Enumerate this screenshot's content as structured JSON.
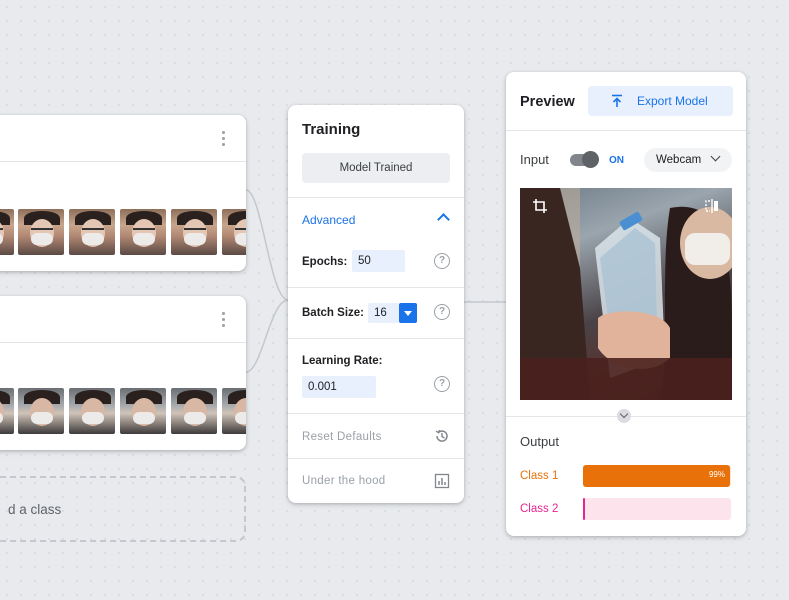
{
  "add_class": {
    "label": "d a class"
  },
  "training": {
    "title": "Training",
    "train_button": "Model Trained",
    "advanced_label": "Advanced",
    "epochs": {
      "label": "Epochs:",
      "value": "50"
    },
    "batch_size": {
      "label": "Batch Size:",
      "value": "16"
    },
    "learning_rate": {
      "label": "Learning Rate:",
      "value": "0.001"
    },
    "reset_defaults": "Reset Defaults",
    "under_the_hood": "Under the hood",
    "help_glyph": "?"
  },
  "preview": {
    "title": "Preview",
    "export_label": "Export Model",
    "input_label": "Input",
    "toggle_state": "ON",
    "source_select": "Webcam",
    "output_label": "Output",
    "classes": [
      {
        "name": "Class 1",
        "confidence": 0.99,
        "percent_text": "99%",
        "color": "#e8710a",
        "track": "#fde6cf"
      },
      {
        "name": "Class 2",
        "confidence": 0.01,
        "percent_text": "",
        "color": "#e52592",
        "track": "#fde4ec"
      }
    ]
  },
  "colors": {
    "accent": "#1a73e8",
    "class1": "#e8710a",
    "class2": "#d4507e"
  },
  "icons": [
    "kebab-icon",
    "chevron-up-icon",
    "help-icon",
    "dropdown-icon",
    "history-icon",
    "chart-icon",
    "upload-icon",
    "crop-icon",
    "flip-icon",
    "arrow-down-icon"
  ]
}
